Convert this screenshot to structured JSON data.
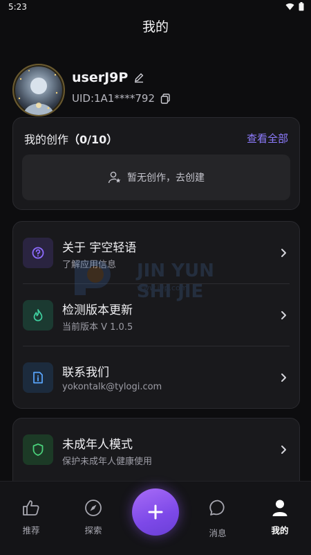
{
  "status": {
    "time": "5:23"
  },
  "header": {
    "title": "我的"
  },
  "profile": {
    "username": "userJ9P",
    "uid": "UID:1A1****792"
  },
  "creations": {
    "title": "我的创作",
    "count": "（0/10）",
    "see_all": "查看全部",
    "empty_text": "暂无创作，去创建"
  },
  "menu": [
    {
      "title": "关于 宇空轻语",
      "subtitle": "了解应用信息",
      "icon": "question-icon",
      "color": "#8e6cff"
    },
    {
      "title": "检测版本更新",
      "subtitle": "当前版本 V 1.0.5",
      "icon": "flame-icon",
      "color": "#3fd0a0"
    },
    {
      "title": "联系我们",
      "subtitle": "yokontalk@tylogi.com",
      "icon": "info-document-icon",
      "color": "#5aa7ff"
    }
  ],
  "minor": {
    "title": "未成年人模式",
    "subtitle": "保护未成年人健康使用",
    "icon": "shield-icon",
    "color": "#4ad07a"
  },
  "watermark": {
    "text": "JIN YUN SHI JIE",
    "url": "www.j9p.com"
  },
  "nav": {
    "items": [
      {
        "label": "推荐",
        "icon": "thumbs-up-icon"
      },
      {
        "label": "探索",
        "icon": "compass-icon"
      },
      {
        "label": "消息",
        "icon": "chat-bubble-icon"
      },
      {
        "label": "我的",
        "icon": "person-icon"
      }
    ],
    "fab_icon": "plus-icon"
  },
  "colors": {
    "accent": "#8e7cff",
    "fab": "#8a55f0",
    "background": "#0d0d0f",
    "card": "#19191c"
  }
}
